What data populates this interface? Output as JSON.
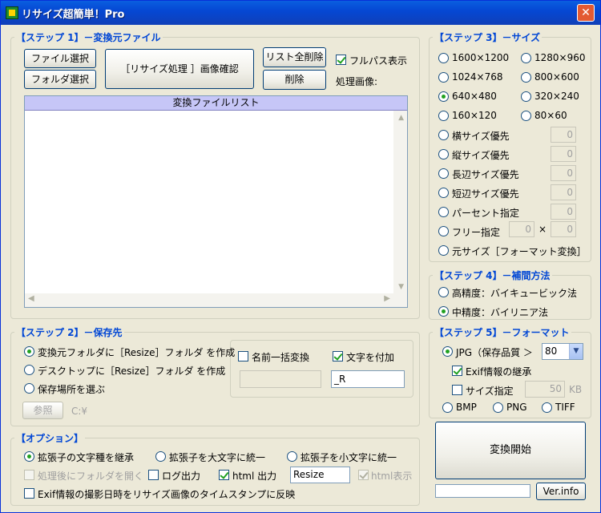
{
  "window": {
    "title": "リサイズ超簡単！Pro",
    "close_glyph": "✕"
  },
  "step1": {
    "title": "【ステップ 1】－変換元ファイル",
    "file_select": "ファイル選択",
    "folder_select": "フォルダ選択",
    "preview": "［リサイズ処理 ］画像確認",
    "clear_all": "リスト全削除",
    "delete": "削除",
    "fullpath_label": "フルパス表示",
    "fullpath_checked": true,
    "processing_label": "処理画像:",
    "list_header": "変換ファイルリスト"
  },
  "step2": {
    "title": "【ステップ 2】－保存先",
    "options": [
      "変換元フォルダに［Resize］フォルダ を作成",
      "デスクトップに［Resize］フォルダ を作成",
      "保存場所を選ぶ"
    ],
    "selected": 0,
    "browse": "参照",
    "path": "C:¥",
    "rename_label": "名前一括変換",
    "rename_checked": false,
    "suffix_label": "文字を付加",
    "suffix_checked": true,
    "suffix_value": "_R"
  },
  "options": {
    "title": "【オプション】",
    "ext_options": [
      "拡張子の文字種を継承",
      "拡張子を大文字に統一",
      "拡張子を小文字に統一"
    ],
    "ext_selected": 0,
    "open_folder": "処理後にフォルダを開く",
    "log_output": "ログ出力",
    "html_output": "html 出力",
    "html_value": "Resize",
    "html_display": "html表示",
    "exif_timestamp": "Exif情報の撮影日時をリサイズ画像のタイムスタンプに反映"
  },
  "step3": {
    "title": "【ステップ 3】－サイズ",
    "sizes": [
      "1600×1200",
      "1280×960",
      "1024×768",
      "800×600",
      "640×480",
      "320×240",
      "160×120",
      "80×60"
    ],
    "selected": "640×480",
    "width_priority": "横サイズ優先",
    "height_priority": "縦サイズ優先",
    "long_priority": "長辺サイズ優先",
    "short_priority": "短辺サイズ優先",
    "percent": "パーセント指定",
    "free": "フリー指定",
    "times": "×",
    "original": "元サイズ［フォーマット変換］",
    "zero": "0"
  },
  "step4": {
    "title": "【ステップ 4】－補間方法",
    "options": [
      "高精度：バイキュービック法",
      "中精度：バイリニア法"
    ],
    "selected": 1
  },
  "step5": {
    "title": "【ステップ 5】－フォーマット",
    "jpg": "JPG（保存品質 ＞",
    "quality": "80",
    "exif": "Exif情報の継承",
    "size_spec": "サイズ指定",
    "size_value": "50",
    "kb": "KB",
    "bmp": "BMP",
    "png": "PNG",
    "tiff": "TIFF",
    "format_selected": "JPG"
  },
  "start": "変換開始",
  "verinfo": "Ver.info",
  "colors": {
    "accent": "#0046d5",
    "title_bar": "#0548d4",
    "list_header": "#c6c6f7",
    "check": "#21a121"
  }
}
